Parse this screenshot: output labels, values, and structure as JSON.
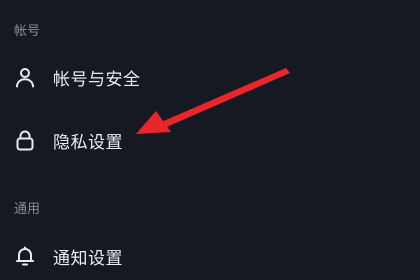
{
  "sections": [
    {
      "header": "帐号",
      "items": [
        {
          "label": "帐号与安全",
          "icon": "user-icon"
        },
        {
          "label": "隐私设置",
          "icon": "lock-icon"
        }
      ]
    },
    {
      "header": "通用",
      "items": [
        {
          "label": "通知设置",
          "icon": "bell-icon"
        }
      ]
    }
  ],
  "annotation": {
    "type": "arrow",
    "color": "#e8262b",
    "target": "隐私设置"
  },
  "colors": {
    "background": "#161922",
    "section_header": "#8a8d96",
    "label": "#eceef2",
    "arrow": "#e8262b"
  }
}
